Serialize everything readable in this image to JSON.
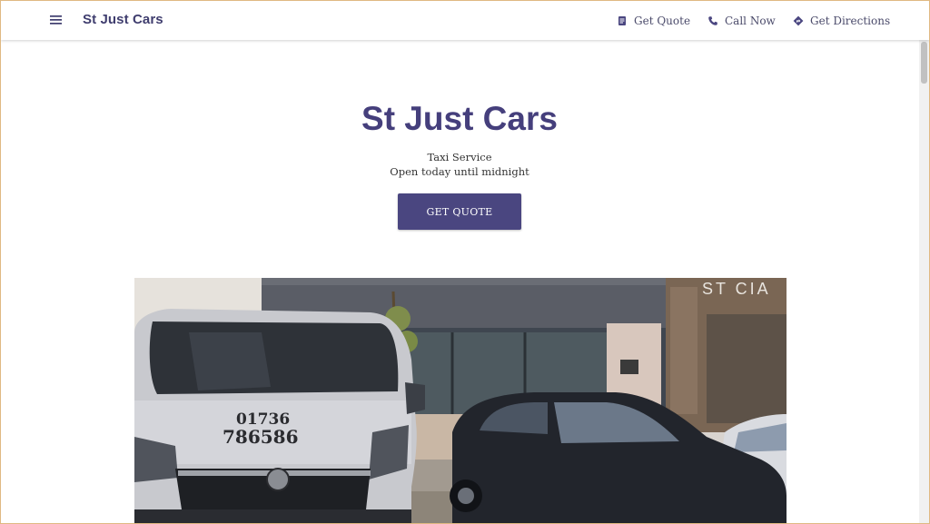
{
  "header": {
    "brand": "St Just Cars",
    "nav": [
      {
        "label": "Get Quote",
        "icon": "document-icon"
      },
      {
        "label": "Call Now",
        "icon": "phone-icon"
      },
      {
        "label": "Get Directions",
        "icon": "directions-icon"
      }
    ]
  },
  "hero": {
    "title": "St Just Cars",
    "subtitle": "Taxi Service",
    "hours": "Open today until midnight",
    "button": "GET QUOTE"
  },
  "photo": {
    "van_phone_line1": "01736",
    "van_phone_line2": "786586",
    "sign_text": "ST CIA"
  },
  "colors": {
    "accent": "#453f7c",
    "button": "#4a4680",
    "frame": "#e0b982"
  }
}
